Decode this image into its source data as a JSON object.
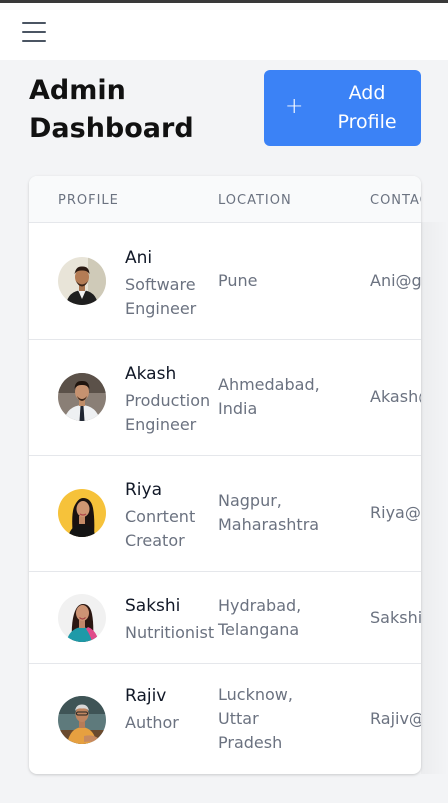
{
  "header": {
    "menu_icon": "hamburger-menu-icon"
  },
  "page": {
    "title_line1": "Admin",
    "title_line2": "Dashboard",
    "add_button": {
      "icon": "+",
      "label_line1": "Add",
      "label_line2": "Profile",
      "color": "#3b82f6"
    }
  },
  "table": {
    "columns": {
      "profile": "PROFILE",
      "location": "LOCATION",
      "contact": "CONTACT"
    },
    "rows": [
      {
        "name": "Ani",
        "role": "Software\nEngineer",
        "location": "Pune",
        "email": "Ani@gmai"
      },
      {
        "name": "Akash",
        "role": "Production\nEngineer",
        "location": "Ahmedabad,\nIndia",
        "email": "Akash@gm"
      },
      {
        "name": "Riya",
        "role": "Conrtent\nCreator",
        "location": "Nagpur,\nMaharashtra",
        "email": "Riya@gma"
      },
      {
        "name": "Sakshi",
        "role": "Nutritionist",
        "location": "Hydrabad,\nTelangana",
        "email": "Sakshi@gr"
      },
      {
        "name": "Rajiv",
        "role": "Author",
        "location": "Lucknow,\nUttar\nPradesh",
        "email": "Rajiv@gma"
      }
    ]
  }
}
